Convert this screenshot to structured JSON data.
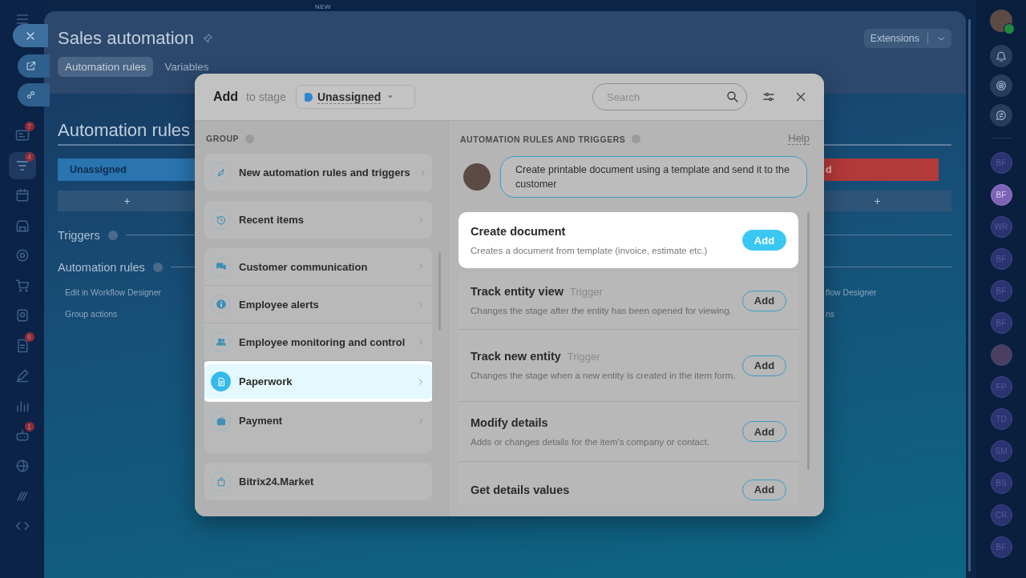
{
  "top_badge": "NEW",
  "left_nav": {
    "items": [
      {
        "active": false,
        "badge": "7"
      },
      {
        "active": true,
        "badge": "4"
      },
      {
        "active": false
      },
      {
        "active": false
      },
      {
        "active": false
      },
      {
        "active": false
      },
      {
        "active": false
      },
      {
        "active": false,
        "badge": "6"
      },
      {
        "active": false
      },
      {
        "active": false
      },
      {
        "active": false,
        "badge": "1"
      },
      {
        "active": false
      },
      {
        "active": false
      },
      {
        "active": false
      }
    ]
  },
  "board": {
    "title": "Sales automation",
    "extensions": "Extensions",
    "tabs": [
      {
        "label": "Automation rules",
        "selected": true
      },
      {
        "label": "Variables",
        "selected": false
      }
    ],
    "heading": "Automation rules",
    "sections": [
      {
        "label": "Triggers"
      },
      {
        "label": "Automation rules"
      }
    ],
    "stages": [
      {
        "name": "Unassigned",
        "color": "#2a74b0",
        "add": "+",
        "links": [
          "Edit in Workflow Designer",
          "Group actions"
        ]
      },
      {
        "name": "d",
        "color": "#b23a3a",
        "add": "+",
        "links": [
          "flow Designer",
          "ns"
        ]
      }
    ]
  },
  "dialog": {
    "title": "Add",
    "stage_label": "to stage",
    "stage": {
      "name": "Unassigned",
      "color": "#2f86cc"
    },
    "search": {
      "placeholder": "Search"
    },
    "groups_title": "GROUP",
    "group_blocks": [
      {
        "items": [
          {
            "label": "New automation rules and triggers",
            "selected": false
          }
        ]
      },
      {
        "items": [
          {
            "label": "Recent items",
            "selected": false
          }
        ]
      },
      {
        "items": [
          {
            "label": "Customer communication",
            "selected": false
          },
          {
            "label": "Employee alerts",
            "selected": false
          },
          {
            "label": "Employee monitoring and control",
            "selected": false
          },
          {
            "label": "Paperwork",
            "selected": true
          },
          {
            "label": "Payment",
            "selected": false
          }
        ]
      }
    ],
    "market": {
      "label": "Bitrix24.Market"
    },
    "rules_title": "AUTOMATION RULES AND TRIGGERS",
    "help": "Help",
    "hint": "Create printable document using a template and send it to the customer",
    "rules": [
      {
        "title": "Create document",
        "description": "Creates a document from template (invoice, estimate etc.)",
        "highlighted": true,
        "button": "Add"
      },
      {
        "title": "Track entity view",
        "tag": "Trigger",
        "description": "Changes the stage after the entity has been opened for viewing.",
        "highlighted": false,
        "button": "Add"
      },
      {
        "title": "Track new entity",
        "tag": "Trigger",
        "description": "Changes the stage when a new entity is created in the item form.",
        "highlighted": false,
        "button": "Add"
      },
      {
        "title": "Modify details",
        "description": "Adds or changes details for the item's company or contact.",
        "highlighted": false,
        "button": "Add"
      },
      {
        "title": "Get details values",
        "highlighted": false,
        "button": "Add"
      }
    ]
  },
  "right_bar": {
    "people": [
      {
        "kind": "initials",
        "initials": "BF",
        "highlighted": false
      },
      {
        "kind": "initials",
        "initials": "BF",
        "highlighted": true
      },
      {
        "kind": "initials",
        "initials": "WR",
        "highlighted": false
      },
      {
        "kind": "initials",
        "initials": "BF",
        "highlighted": false
      },
      {
        "kind": "initials",
        "initials": "BF",
        "highlighted": false
      },
      {
        "kind": "initials",
        "initials": "BF",
        "highlighted": false
      },
      {
        "kind": "photo"
      },
      {
        "kind": "initials",
        "initials": "FP",
        "highlighted": false
      },
      {
        "kind": "initials",
        "initials": "TD",
        "highlighted": false
      },
      {
        "kind": "initials",
        "initials": "SM",
        "highlighted": false
      },
      {
        "kind": "initials",
        "initials": "BS",
        "highlighted": false
      },
      {
        "kind": "initials",
        "initials": "CR",
        "highlighted": false
      },
      {
        "kind": "initials",
        "initials": "BF",
        "highlighted": false
      }
    ]
  }
}
